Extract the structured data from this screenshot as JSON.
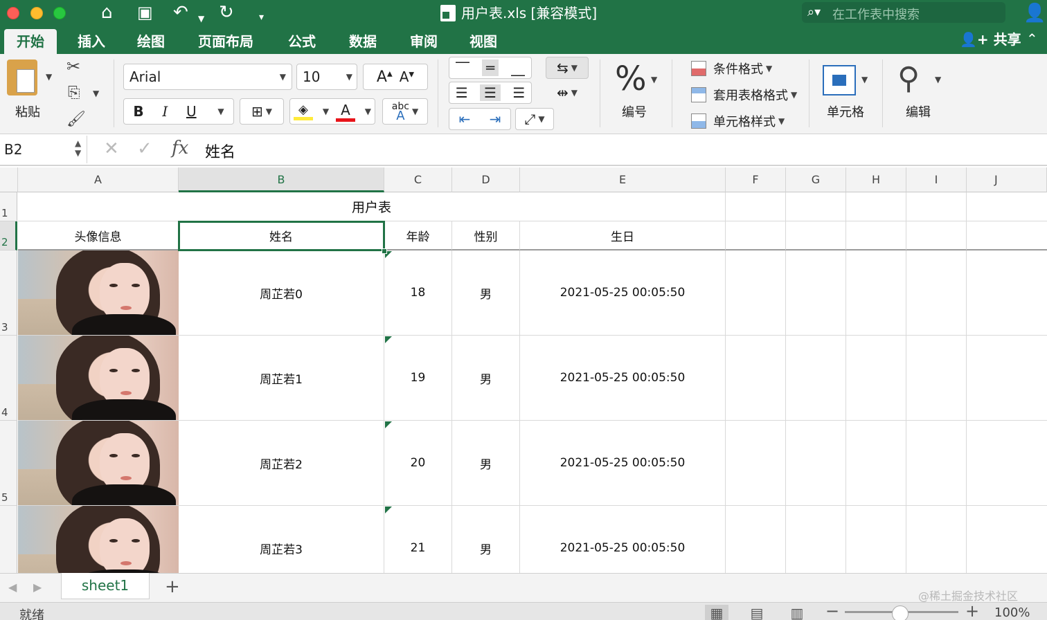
{
  "window": {
    "title": "用户表.xls  [兼容模式]",
    "search_placeholder": "在工作表中搜索"
  },
  "tabs": [
    {
      "label": "开始",
      "active": true
    },
    {
      "label": "插入"
    },
    {
      "label": "绘图"
    },
    {
      "label": "页面布局"
    },
    {
      "label": "公式"
    },
    {
      "label": "数据"
    },
    {
      "label": "审阅"
    },
    {
      "label": "视图"
    }
  ],
  "share_label": "共享",
  "ribbon": {
    "paste_label": "粘贴",
    "font_name": "Arial",
    "font_size": "10",
    "bold": "B",
    "italic": "I",
    "underline": "U",
    "font_color_letter": "A",
    "grow_font": "A",
    "shrink_font": "A",
    "abc_text": "abc",
    "number_label": "编号",
    "percent": "%",
    "conditional_format": "条件格式",
    "table_format": "套用表格格式",
    "cell_style": "单元格样式",
    "cells_label": "单元格",
    "edit_label": "编辑",
    "accent_color": "#217346",
    "highlight_color": "#ffeb3b",
    "font_color": "#e8141a"
  },
  "formula_bar": {
    "name_box": "B2",
    "fx": "fx",
    "value": "姓名"
  },
  "sheet": {
    "columns": [
      "A",
      "B",
      "C",
      "D",
      "E",
      "F",
      "G",
      "H",
      "I",
      "J"
    ],
    "selected_column": "B",
    "selected_cell": "B2",
    "row_numbers": [
      "1",
      "2",
      "3",
      "4",
      "5"
    ],
    "title": "用户表",
    "headers": [
      "头像信息",
      "姓名",
      "年龄",
      "性别",
      "生日"
    ],
    "rows": [
      {
        "name": "周芷若0",
        "age": "18",
        "gender": "男",
        "birthday": "2021-05-25 00:05:50"
      },
      {
        "name": "周芷若1",
        "age": "19",
        "gender": "男",
        "birthday": "2021-05-25 00:05:50"
      },
      {
        "name": "周芷若2",
        "age": "20",
        "gender": "男",
        "birthday": "2021-05-25 00:05:50"
      },
      {
        "name": "周芷若3",
        "age": "21",
        "gender": "男",
        "birthday": "2021-05-25 00:05:50"
      }
    ]
  },
  "sheet_tabs": [
    {
      "label": "sheet1",
      "active": true
    }
  ],
  "status": {
    "text": "就绪",
    "zoom": "100%"
  },
  "watermark": "@稀土掘金技术社区"
}
